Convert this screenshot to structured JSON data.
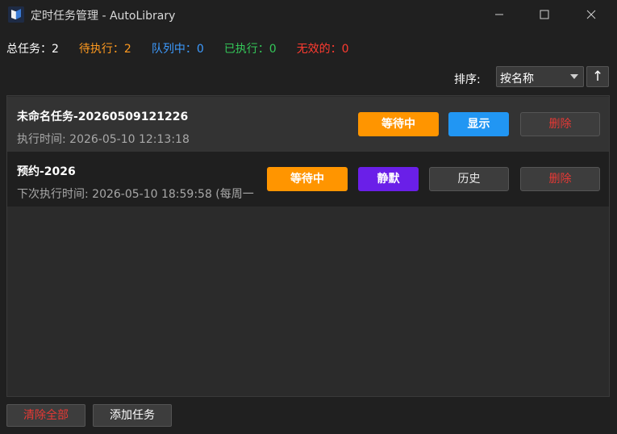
{
  "window": {
    "title": "定时任务管理 - AutoLibrary",
    "icons": {
      "app": "book-icon",
      "minimize": "minimize-icon",
      "maximize": "maximize-icon",
      "close": "close-icon"
    }
  },
  "stats": {
    "total": "总任务：2",
    "pending": "待执行：2",
    "queue": "队列中：0",
    "done": "已执行：0",
    "invalid": "无效的：0"
  },
  "sort": {
    "label": "排序:",
    "selected": "按名称",
    "direction": "↑"
  },
  "tasks": [
    {
      "name": "未命名任务-20260509121226",
      "time": "执行时间: 2026-05-10 12:13:18",
      "status_label": "等待中",
      "show_label": "显示",
      "delete_label": "删除"
    },
    {
      "name": "预约-2026",
      "time": "下次执行时间: 2026-05-10 18:59:58 (每周一",
      "status_label": "等待中",
      "silent_label": "静默",
      "history_label": "历史",
      "delete_label": "删除"
    }
  ],
  "footer": {
    "clear_all": "清除全部",
    "add_task": "添加任务"
  },
  "colors": {
    "pending": "#ff9a1f",
    "queue": "#3d9bff",
    "done": "#34c759",
    "invalid": "#ff3b30",
    "status_button": "#ff9500",
    "show_button": "#2196f3",
    "silent_button": "#6a1fe8",
    "delete_text": "#e53935"
  }
}
